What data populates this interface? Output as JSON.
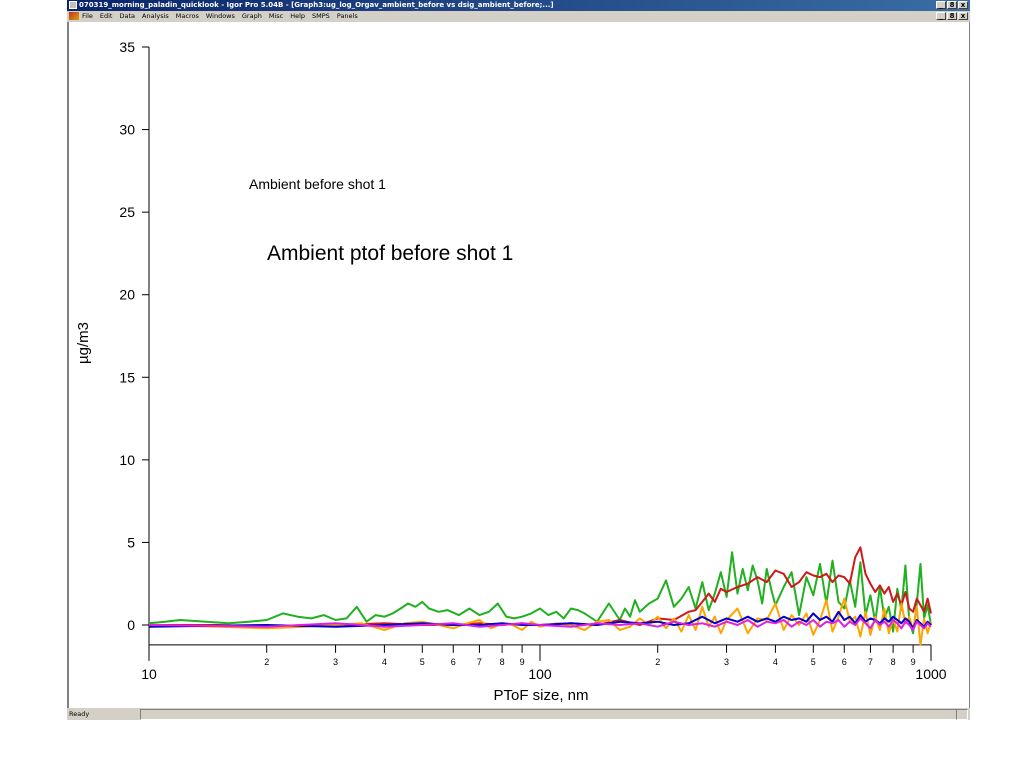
{
  "window": {
    "title": "070319_morning_paladin_quicklook - Igor Pro 5.04B - [Graph3:ug_log_Orgav_ambient_before vs dsig_ambient_before;...]",
    "app_icon": "igor-app-icon",
    "controls": [
      "_",
      "8",
      "x"
    ]
  },
  "menu": {
    "items": [
      "File",
      "Edit",
      "Data",
      "Analysis",
      "Macros",
      "Windows",
      "Graph",
      "Misc",
      "Help",
      "SMPS",
      "Panels"
    ],
    "doc_controls": [
      "_",
      "8",
      "x"
    ]
  },
  "status": {
    "text": "Ready"
  },
  "chart_data": {
    "type": "line",
    "title": "Ambient ptof before shot 1",
    "subtitle": "Ambient before shot 1",
    "xlabel": "PToF size, nm",
    "ylabel": "µg/m3",
    "xscale": "log",
    "xlim": [
      10,
      1000
    ],
    "ylim": [
      -1.2,
      35
    ],
    "yticks": [
      0,
      5,
      10,
      15,
      20,
      25,
      30,
      35
    ],
    "xtick_major_labels": [
      "10",
      "100",
      "1000"
    ],
    "xtick_minor_labels": [
      "2",
      "3",
      "4",
      "5",
      "6",
      "7",
      "8",
      "9"
    ],
    "grid": false,
    "legend": "none",
    "series": [
      {
        "color": "#20b020",
        "x": [
          10,
          11,
          12,
          14,
          16,
          18,
          20,
          22,
          24,
          26,
          28,
          30,
          32,
          34,
          36,
          38,
          40,
          42,
          44,
          46,
          48,
          50,
          52,
          55,
          58,
          62,
          66,
          70,
          74,
          78,
          82,
          86,
          90,
          95,
          100,
          105,
          110,
          115,
          120,
          125,
          130,
          140,
          150,
          160,
          165,
          170,
          175,
          180,
          190,
          200,
          210,
          220,
          230,
          240,
          250,
          260,
          270,
          280,
          290,
          300,
          310,
          320,
          330,
          340,
          350,
          360,
          370,
          380,
          390,
          400,
          420,
          440,
          460,
          480,
          500,
          520,
          540,
          560,
          580,
          600,
          620,
          640,
          660,
          680,
          700,
          720,
          740,
          760,
          780,
          800,
          820,
          840,
          860,
          880,
          900,
          920,
          940,
          960,
          980,
          1000
        ],
        "values": [
          0.1,
          0.2,
          0.3,
          0.2,
          0.1,
          0.2,
          0.3,
          0.7,
          0.5,
          0.4,
          0.6,
          0.3,
          0.4,
          1.1,
          0.2,
          0.6,
          0.5,
          0.7,
          1.0,
          1.3,
          1.1,
          1.4,
          1.0,
          0.8,
          0.9,
          0.6,
          1.0,
          0.6,
          0.8,
          1.3,
          0.5,
          0.4,
          0.5,
          0.7,
          1.0,
          0.6,
          0.8,
          0.4,
          1.0,
          0.9,
          0.7,
          0.2,
          1.3,
          0.3,
          1.0,
          0.5,
          1.5,
          0.8,
          1.3,
          1.6,
          2.7,
          1.1,
          1.6,
          2.3,
          1.0,
          2.6,
          0.9,
          1.9,
          3.2,
          1.7,
          4.4,
          1.9,
          3.4,
          2.1,
          3.6,
          2.7,
          1.3,
          3.4,
          2.2,
          1.2,
          2.3,
          3.2,
          0.6,
          2.9,
          1.8,
          3.7,
          1.3,
          3.9,
          1.4,
          1.0,
          2.7,
          1.1,
          3.8,
          0.6,
          1.8,
          0.2,
          2.3,
          0.4,
          1.1,
          -0.4,
          2.2,
          0.9,
          3.6,
          0.2,
          -0.5,
          1.3,
          3.7,
          0.4,
          1.2,
          0.0
        ]
      },
      {
        "color": "#d01818",
        "x": [
          10,
          15,
          20,
          25,
          30,
          40,
          50,
          60,
          70,
          80,
          90,
          100,
          120,
          140,
          160,
          180,
          200,
          220,
          240,
          250,
          260,
          270,
          280,
          290,
          300,
          320,
          340,
          360,
          380,
          400,
          420,
          440,
          460,
          480,
          500,
          520,
          540,
          560,
          580,
          600,
          620,
          640,
          660,
          680,
          700,
          720,
          740,
          760,
          780,
          800,
          820,
          840,
          860,
          880,
          900,
          920,
          940,
          960,
          980,
          1000
        ],
        "values": [
          0.0,
          0.0,
          -0.1,
          0.0,
          0.0,
          0.1,
          0.0,
          0.0,
          0.1,
          0.0,
          0.1,
          0.0,
          0.1,
          0.0,
          0.3,
          0.0,
          0.4,
          0.3,
          0.8,
          0.9,
          1.4,
          1.9,
          1.4,
          2.2,
          2.0,
          2.3,
          2.5,
          2.9,
          2.6,
          3.3,
          3.1,
          2.3,
          2.6,
          3.2,
          3.0,
          2.9,
          3.1,
          2.6,
          3.0,
          2.9,
          2.5,
          4.1,
          4.7,
          3.1,
          2.5,
          2.0,
          2.4,
          1.9,
          2.3,
          1.4,
          1.9,
          1.2,
          2.0,
          1.0,
          0.8,
          1.6,
          1.2,
          0.8,
          1.6,
          0.7
        ]
      },
      {
        "color": "#ffa500",
        "x": [
          10,
          15,
          20,
          25,
          30,
          35,
          40,
          45,
          50,
          55,
          60,
          65,
          70,
          75,
          80,
          85,
          90,
          95,
          100,
          110,
          120,
          130,
          140,
          150,
          160,
          170,
          180,
          190,
          200,
          210,
          220,
          230,
          240,
          250,
          260,
          270,
          280,
          290,
          300,
          320,
          340,
          360,
          380,
          400,
          420,
          440,
          460,
          480,
          500,
          520,
          540,
          560,
          580,
          600,
          620,
          640,
          660,
          680,
          700,
          720,
          740,
          760,
          780,
          800,
          820,
          840,
          860,
          880,
          900,
          920,
          940,
          960,
          980,
          1000
        ],
        "values": [
          0.0,
          -0.1,
          -0.2,
          -0.1,
          0.0,
          0.1,
          -0.3,
          0.1,
          0.2,
          0.0,
          -0.2,
          0.1,
          0.3,
          -0.2,
          0.1,
          0.0,
          -0.3,
          0.2,
          -0.1,
          0.1,
          0.0,
          -0.3,
          0.2,
          0.3,
          -0.3,
          -0.1,
          0.4,
          0.0,
          0.5,
          -0.2,
          0.4,
          -0.4,
          0.6,
          -0.3,
          1.1,
          -0.1,
          0.5,
          -0.5,
          0.3,
          1.0,
          -0.5,
          0.4,
          0.3,
          1.3,
          -0.3,
          0.6,
          0.0,
          0.7,
          -0.6,
          0.3,
          1.5,
          -0.4,
          0.5,
          1.6,
          0.2,
          0.5,
          -0.7,
          0.8,
          -0.6,
          0.5,
          -0.3,
          1.0,
          -0.5,
          0.4,
          -0.4,
          1.3,
          0.1,
          0.5,
          -0.3,
          1.1,
          -1.2,
          0.4,
          -0.5,
          0.2
        ]
      },
      {
        "color": "#0000cc",
        "x": [
          10,
          20,
          30,
          40,
          50,
          60,
          70,
          80,
          90,
          100,
          120,
          140,
          160,
          180,
          200,
          220,
          240,
          260,
          280,
          300,
          320,
          340,
          360,
          380,
          400,
          420,
          440,
          460,
          480,
          500,
          520,
          540,
          560,
          580,
          600,
          620,
          640,
          660,
          680,
          700,
          720,
          740,
          760,
          780,
          800,
          820,
          840,
          860,
          880,
          900,
          920,
          940,
          960,
          980,
          1000
        ],
        "values": [
          -0.1,
          0.0,
          -0.1,
          0.0,
          0.1,
          0.0,
          0.0,
          0.1,
          0.0,
          0.0,
          0.1,
          0.0,
          0.2,
          0.1,
          0.2,
          0.0,
          0.1,
          0.5,
          0.1,
          0.4,
          0.2,
          0.5,
          0.2,
          0.4,
          0.2,
          0.5,
          0.3,
          0.4,
          0.2,
          0.7,
          0.3,
          0.5,
          0.2,
          0.8,
          0.3,
          0.5,
          0.1,
          0.6,
          0.2,
          0.4,
          0.3,
          0.1,
          0.4,
          0.2,
          0.5,
          0.3,
          0.1,
          0.4,
          0.2,
          -0.2,
          0.3,
          0.1,
          -0.1,
          0.2,
          0.0
        ]
      },
      {
        "color": "#e020e0",
        "x": [
          10,
          20,
          30,
          40,
          50,
          60,
          70,
          80,
          90,
          100,
          120,
          140,
          160,
          180,
          200,
          220,
          240,
          260,
          280,
          300,
          320,
          340,
          360,
          380,
          400,
          420,
          440,
          460,
          480,
          500,
          520,
          540,
          560,
          580,
          600,
          620,
          640,
          660,
          680,
          700,
          720,
          740,
          760,
          780,
          800,
          820,
          840,
          860,
          880,
          900,
          920,
          940,
          960,
          980,
          1000
        ],
        "values": [
          0.0,
          -0.1,
          0.1,
          -0.1,
          0.0,
          0.1,
          -0.1,
          0.0,
          0.1,
          0.0,
          -0.1,
          0.1,
          0.0,
          0.1,
          -0.1,
          0.2,
          0.0,
          0.1,
          -0.1,
          0.2,
          0.0,
          0.3,
          -0.1,
          0.2,
          0.1,
          0.3,
          -0.1,
          0.2,
          0.0,
          0.3,
          -0.1,
          0.2,
          0.1,
          0.3,
          -0.1,
          0.2,
          0.0,
          0.4,
          0.1,
          -0.2,
          0.3,
          0.0,
          0.2,
          -0.1,
          0.3,
          0.1,
          -0.2,
          0.2,
          0.0,
          -0.3,
          0.2,
          0.0,
          -0.2,
          0.1,
          -0.1
        ]
      }
    ]
  }
}
